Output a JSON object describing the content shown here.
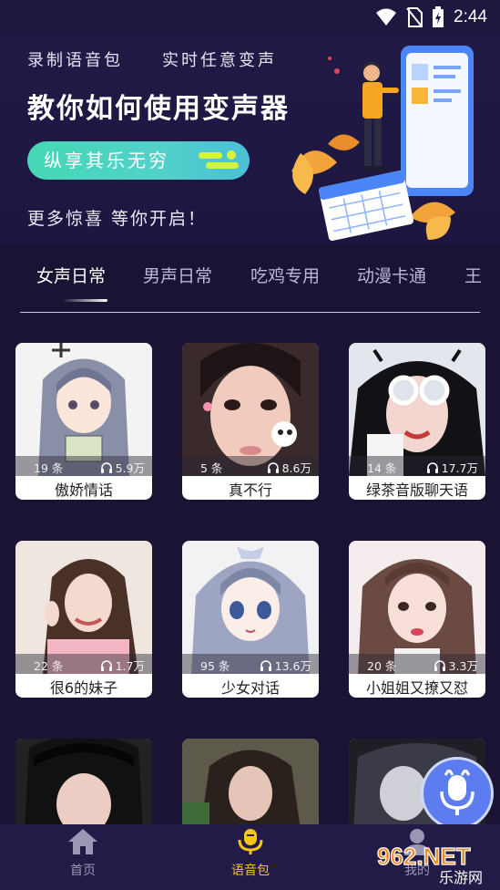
{
  "status_bar": {
    "time": "2:44"
  },
  "banner": {
    "tag1": "录制语音包",
    "tag2": "实时任意变声",
    "title": "教你如何使用变声器",
    "pill": "纵享其乐无穷",
    "tagline": "更多惊喜 等你开启！"
  },
  "tabs": [
    "女声日常",
    "男声日常",
    "吃鸡专用",
    "动漫卡通",
    "王"
  ],
  "cards": [
    {
      "count": "19 条",
      "listens": "5.9万",
      "title": "傲娇情话"
    },
    {
      "count": "5 条",
      "listens": "8.6万",
      "title": "真不行"
    },
    {
      "count": "14 条",
      "listens": "17.7万",
      "title": "绿茶音版聊天语"
    },
    {
      "count": "22 条",
      "listens": "1.7万",
      "title": "很6的妹子"
    },
    {
      "count": "95 条",
      "listens": "13.6万",
      "title": "少女对话"
    },
    {
      "count": "20 条",
      "listens": "3.3万",
      "title": "小姐姐又撩又怼"
    }
  ],
  "nav": {
    "home": "首页",
    "voice_pack": "语音包",
    "mine": "我的"
  },
  "watermark": {
    "brand": "962.NET",
    "sub": "乐游网"
  },
  "colors": {
    "accent_teal": "#45d8b5",
    "nav_active": "#f5c518",
    "mic_blue": "#5c7cf0"
  }
}
